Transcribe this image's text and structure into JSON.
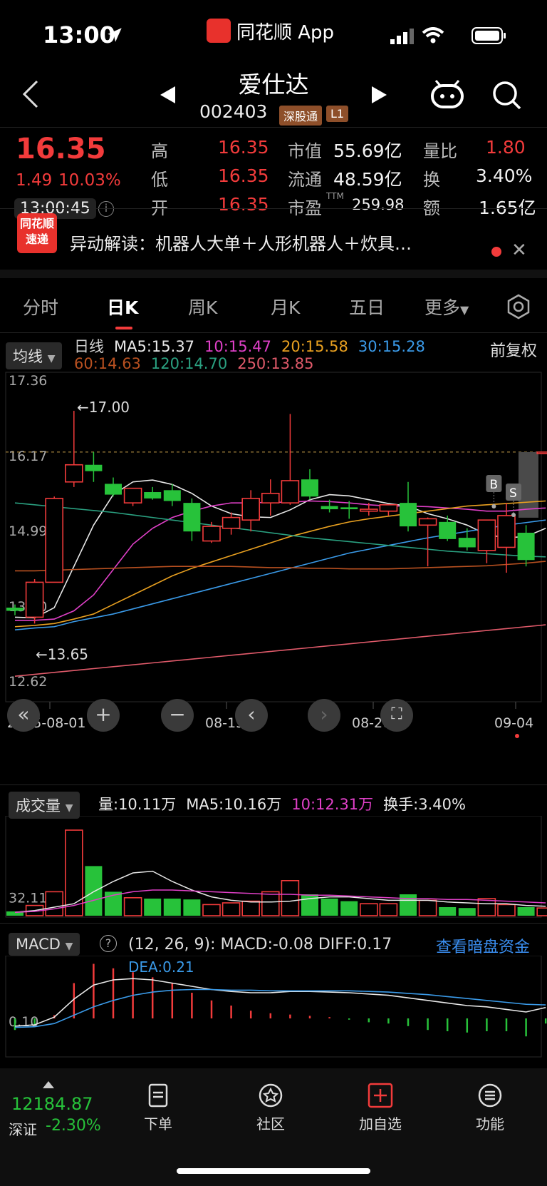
{
  "status": {
    "time": "13:00",
    "app_name": "同花顺 App"
  },
  "header": {
    "name": "爱仕达",
    "code": "002403",
    "tags": [
      "深股通",
      "L1"
    ]
  },
  "quote": {
    "price": "16.35",
    "change": "1.49",
    "change_pct": "10.03%",
    "time": "13:00:45",
    "rows": [
      {
        "l1": "高",
        "v1": "16.35",
        "l2": "市值",
        "v2": "55.69亿",
        "l3": "量比",
        "v3": "1.80"
      },
      {
        "l1": "低",
        "v1": "16.35",
        "l2": "流通",
        "v2": "48.59亿",
        "l3": "换",
        "v3": "3.40%"
      },
      {
        "l1": "开",
        "v1": "16.35",
        "l2": "市盈",
        "l2_sup": "TTM",
        "v2": "259.98",
        "l3": "额",
        "v3": "1.65亿"
      }
    ]
  },
  "news": {
    "badge_l1": "同花顺",
    "badge_l2": "速递",
    "text": "异动解读：机器人大单＋人形机器人＋炊具…"
  },
  "tabs": [
    "分时",
    "日K",
    "周K",
    "月K",
    "五日",
    "更多"
  ],
  "kline": {
    "ma_selector": "均线",
    "adjust": "前复权",
    "ma_row1": [
      {
        "text": "日线",
        "color": "#cfcfcf"
      },
      {
        "text": "MA5:15.37",
        "color": "#e8e8e8"
      },
      {
        "text": "10:15.47",
        "color": "#e040c8"
      },
      {
        "text": "20:15.58",
        "color": "#e8a020"
      },
      {
        "text": "30:15.28",
        "color": "#3a9ae8"
      }
    ],
    "ma_row2": [
      {
        "text": "60:14.63",
        "color": "#b85020"
      },
      {
        "text": "120:14.70",
        "color": "#2aa080"
      },
      {
        "text": "250:13.85",
        "color": "#e05a6a"
      }
    ],
    "y_labels": [
      "17.36",
      "16.17",
      "14.99",
      "13.80",
      "12.62"
    ],
    "high_mark": "←17.00",
    "low_mark": "←13.65",
    "dates": [
      "2025-08-01",
      "08-15",
      "08-26",
      "09-04"
    ],
    "markers": [
      "B",
      "S"
    ]
  },
  "volume": {
    "selector": "成交量",
    "items": [
      {
        "text": "量:10.11万",
        "color": "#e8e8e8"
      },
      {
        "text": "MA5:10.16万",
        "color": "#e8e8e8"
      },
      {
        "text": "10:12.31万",
        "color": "#e040c8"
      },
      {
        "text": "换手:3.40%",
        "color": "#e8e8e8"
      }
    ],
    "y_label": "32.11万"
  },
  "macd": {
    "selector": "MACD",
    "params": "(12, 26, 9):",
    "macd_val": "MACD:-0.08",
    "diff_val": "DIFF:0.17",
    "dea_val": "DEA:0.21",
    "link": "查看暗盘资金",
    "y_label": "0.10"
  },
  "bottom": {
    "index_value": "12184.87",
    "index_name": "深证",
    "index_change": "-2.30%",
    "nav": [
      "下单",
      "社区",
      "加自选",
      "功能"
    ]
  },
  "colors": {
    "up": "#f23b3b",
    "down": "#27c23a",
    "background": "#000000"
  },
  "chart_data": {
    "type": "candlestick",
    "title": "",
    "ylim": [
      12.62,
      17.36
    ],
    "x_ticks": [
      "2025-08-01",
      "08-15",
      "08-26",
      "09-04"
    ],
    "candles": [
      {
        "o": 13.9,
        "h": 13.95,
        "l": 13.78,
        "c": 13.85
      },
      {
        "o": 13.75,
        "h": 14.35,
        "l": 13.65,
        "c": 14.3
      },
      {
        "o": 14.3,
        "h": 15.65,
        "l": 14.3,
        "c": 15.62
      },
      {
        "o": 15.88,
        "h": 17.0,
        "l": 15.8,
        "c": 16.15
      },
      {
        "o": 16.15,
        "h": 16.35,
        "l": 15.88,
        "c": 16.05
      },
      {
        "o": 15.85,
        "h": 15.95,
        "l": 15.65,
        "c": 15.68
      },
      {
        "o": 15.55,
        "h": 15.65,
        "l": 15.5,
        "c": 15.78
      },
      {
        "o": 15.72,
        "h": 15.8,
        "l": 15.6,
        "c": 15.62
      },
      {
        "o": 15.75,
        "h": 15.85,
        "l": 15.5,
        "c": 15.58
      },
      {
        "o": 15.55,
        "h": 15.62,
        "l": 14.95,
        "c": 15.1
      },
      {
        "o": 14.95,
        "h": 15.25,
        "l": 14.92,
        "c": 15.18
      },
      {
        "o": 15.15,
        "h": 15.4,
        "l": 15.05,
        "c": 15.32
      },
      {
        "o": 15.28,
        "h": 15.75,
        "l": 15.1,
        "c": 15.62
      },
      {
        "o": 15.55,
        "h": 15.92,
        "l": 15.35,
        "c": 15.7
      },
      {
        "o": 15.55,
        "h": 16.95,
        "l": 15.52,
        "c": 15.9
      },
      {
        "o": 15.92,
        "h": 16.08,
        "l": 15.6,
        "c": 15.65
      },
      {
        "o": 15.5,
        "h": 15.6,
        "l": 15.4,
        "c": 15.45
      },
      {
        "o": 15.48,
        "h": 15.58,
        "l": 15.3,
        "c": 15.45
      },
      {
        "o": 15.42,
        "h": 15.55,
        "l": 15.35,
        "c": 15.45
      },
      {
        "o": 15.42,
        "h": 15.5,
        "l": 15.35,
        "c": 15.52
      },
      {
        "o": 15.55,
        "h": 15.88,
        "l": 15.1,
        "c": 15.18
      },
      {
        "o": 15.2,
        "h": 15.32,
        "l": 14.55,
        "c": 15.3
      },
      {
        "o": 15.25,
        "h": 15.35,
        "l": 14.95,
        "c": 14.98
      },
      {
        "o": 15.0,
        "h": 15.15,
        "l": 14.8,
        "c": 14.85
      },
      {
        "o": 14.8,
        "h": 15.15,
        "l": 14.6,
        "c": 15.28
      },
      {
        "o": 14.85,
        "h": 15.55,
        "l": 14.45,
        "c": 15.35
      },
      {
        "o": 15.08,
        "h": 15.2,
        "l": 14.55,
        "c": 14.65
      },
      {
        "o": 16.35,
        "h": 16.35,
        "l": 16.35,
        "c": 16.35
      }
    ],
    "ma_lines": [
      {
        "name": "MA5",
        "color": "#e8e8e8",
        "values": [
          13.75,
          13.74,
          13.9,
          14.55,
          15.2,
          15.68,
          15.88,
          15.91,
          15.84,
          15.7,
          15.5,
          15.38,
          15.33,
          15.32,
          15.44,
          15.6,
          15.68,
          15.66,
          15.6,
          15.54,
          15.5,
          15.38,
          15.3,
          15.2,
          15.05,
          15.0,
          15.02,
          15.15
        ]
      },
      {
        "name": "10",
        "color": "#e040c8",
        "values": [
          13.7,
          13.7,
          13.72,
          13.85,
          14.1,
          14.5,
          14.9,
          15.15,
          15.32,
          15.42,
          15.5,
          15.55,
          15.55,
          15.56,
          15.56,
          15.58,
          15.57,
          15.55,
          15.52,
          15.5,
          15.5,
          15.49,
          15.47,
          15.45,
          15.42,
          15.42,
          15.45,
          15.47
        ]
      },
      {
        "name": "20",
        "color": "#e8a020",
        "values": [
          13.6,
          13.62,
          13.65,
          13.72,
          13.8,
          13.95,
          14.1,
          14.25,
          14.4,
          14.52,
          14.62,
          14.72,
          14.82,
          14.92,
          15.02,
          15.1,
          15.18,
          15.25,
          15.3,
          15.34,
          15.38,
          15.42,
          15.46,
          15.5,
          15.52,
          15.54,
          15.56,
          15.58
        ]
      },
      {
        "name": "30",
        "color": "#3a9ae8",
        "values": [
          13.55,
          13.58,
          13.6,
          13.68,
          13.74,
          13.8,
          13.88,
          13.96,
          14.04,
          14.12,
          14.2,
          14.28,
          14.36,
          14.44,
          14.52,
          14.6,
          14.68,
          14.76,
          14.82,
          14.88,
          14.94,
          15.0,
          15.05,
          15.1,
          15.15,
          15.2,
          15.24,
          15.28
        ]
      },
      {
        "name": "60",
        "color": "#b85020",
        "values": [
          14.48,
          14.48,
          14.49,
          14.5,
          14.51,
          14.52,
          14.53,
          14.54,
          14.55,
          14.55,
          14.55,
          14.55,
          14.54,
          14.53,
          14.53,
          14.52,
          14.52,
          14.51,
          14.51,
          14.51,
          14.52,
          14.53,
          14.54,
          14.55,
          14.56,
          14.58,
          14.6,
          14.63
        ]
      },
      {
        "name": "120",
        "color": "#2aa080",
        "values": [
          15.55,
          15.52,
          15.49,
          15.46,
          15.43,
          15.4,
          15.36,
          15.32,
          15.28,
          15.24,
          15.2,
          15.16,
          15.12,
          15.08,
          15.04,
          15.0,
          14.97,
          14.94,
          14.91,
          14.88,
          14.85,
          14.82,
          14.79,
          14.77,
          14.75,
          14.73,
          14.71,
          14.7
        ]
      },
      {
        "name": "250",
        "color": "#e05a6a",
        "values": [
          12.82,
          12.85,
          12.88,
          12.91,
          12.94,
          12.97,
          13.0,
          13.03,
          13.06,
          13.09,
          13.12,
          13.15,
          13.18,
          13.21,
          13.24,
          13.27,
          13.3,
          13.33,
          13.36,
          13.39,
          13.42,
          13.45,
          13.48,
          13.51,
          13.54,
          13.57,
          13.6,
          13.63
        ]
      }
    ],
    "volume": [
      5,
      12,
      28,
      100,
      58,
      28,
      21,
      20,
      20,
      19,
      13,
      15,
      17,
      28,
      41,
      25,
      20,
      17,
      14,
      14,
      25,
      18,
      10,
      9,
      20,
      13,
      10,
      9
    ],
    "volume_ma5": [
      4,
      6,
      10,
      14,
      28,
      40,
      50,
      52,
      40,
      30,
      22,
      18,
      16,
      16,
      17,
      20,
      22,
      22,
      20,
      18,
      18,
      18,
      16,
      15,
      14,
      14,
      12,
      11
    ],
    "volume_ma10": [
      4,
      5,
      8,
      12,
      18,
      24,
      28,
      30,
      30,
      29,
      28,
      27,
      26,
      25,
      25,
      24,
      24,
      23,
      22,
      21,
      20,
      20,
      19,
      19,
      18,
      17,
      16,
      15
    ],
    "macd_hist": [
      -0.18,
      -0.1,
      0.05,
      0.55,
      0.85,
      0.78,
      0.72,
      0.64,
      0.55,
      0.4,
      0.28,
      0.2,
      0.12,
      0.08,
      0.06,
      0.04,
      0.02,
      -0.02,
      -0.06,
      -0.08,
      -0.12,
      -0.18,
      -0.2,
      -0.22,
      -0.2,
      -0.2,
      -0.28,
      -0.08
    ],
    "diff": [
      -0.12,
      -0.1,
      0.02,
      0.3,
      0.52,
      0.6,
      0.62,
      0.6,
      0.55,
      0.5,
      0.45,
      0.42,
      0.4,
      0.4,
      0.42,
      0.42,
      0.41,
      0.4,
      0.38,
      0.36,
      0.32,
      0.28,
      0.24,
      0.2,
      0.18,
      0.14,
      0.1,
      0.17
    ],
    "dea": [
      -0.14,
      -0.13,
      -0.08,
      0.05,
      0.18,
      0.28,
      0.36,
      0.41,
      0.44,
      0.45,
      0.45,
      0.44,
      0.44,
      0.43,
      0.43,
      0.43,
      0.43,
      0.43,
      0.42,
      0.41,
      0.39,
      0.37,
      0.34,
      0.31,
      0.28,
      0.25,
      0.22,
      0.21
    ]
  }
}
